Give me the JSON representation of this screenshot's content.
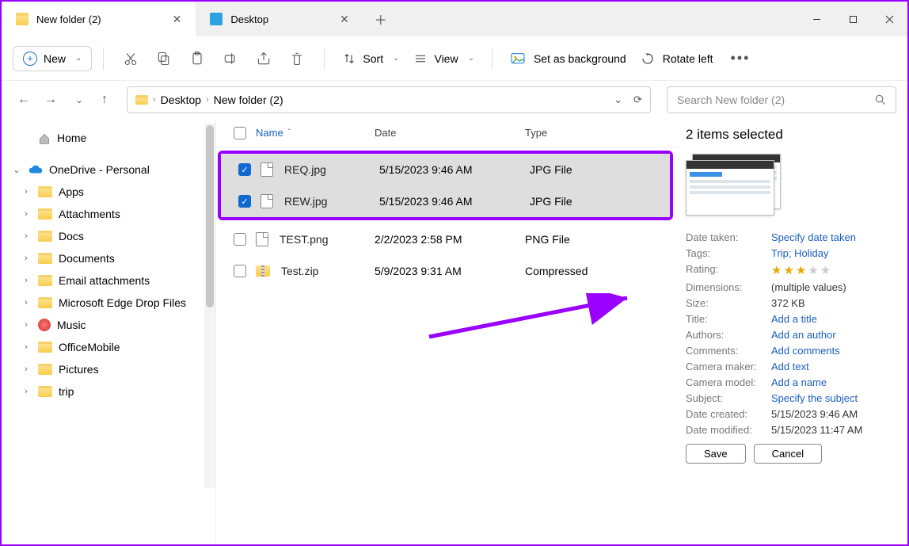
{
  "tabs": [
    {
      "label": "New folder (2)",
      "active": true
    },
    {
      "label": "Desktop",
      "active": false
    }
  ],
  "toolbar": {
    "new": "New",
    "sort": "Sort",
    "view": "View",
    "set_bg": "Set as background",
    "rotate": "Rotate left"
  },
  "breadcrumb": [
    "Desktop",
    "New folder (2)"
  ],
  "search": {
    "placeholder": "Search New folder (2)"
  },
  "nav": {
    "home": "Home",
    "onedrive": "OneDrive - Personal",
    "items": [
      "Apps",
      "Attachments",
      "Docs",
      "Documents",
      "Email attachments",
      "Microsoft Edge Drop Files",
      "Music",
      "OfficeMobile",
      "Pictures",
      "trip"
    ]
  },
  "columns": {
    "name": "Name",
    "date": "Date",
    "type": "Type"
  },
  "rows": [
    {
      "name": "REQ.jpg",
      "date": "5/15/2023 9:46 AM",
      "type": "JPG File",
      "selected": true,
      "icon": "file"
    },
    {
      "name": "REW.jpg",
      "date": "5/15/2023 9:46 AM",
      "type": "JPG File",
      "selected": true,
      "icon": "file"
    },
    {
      "name": "TEST.png",
      "date": "2/2/2023 2:58 PM",
      "type": "PNG File",
      "selected": false,
      "icon": "file"
    },
    {
      "name": "Test.zip",
      "date": "5/9/2023 9:31 AM",
      "type": "Compressed",
      "selected": false,
      "icon": "zip"
    }
  ],
  "details": {
    "title": "2 items selected",
    "rows": [
      {
        "k": "Date taken:",
        "v": "Specify date taken",
        "link": true
      },
      {
        "k": "Tags:",
        "v": "Trip; Holiday",
        "link": true
      },
      {
        "k": "Rating:",
        "v": "",
        "stars": 3
      },
      {
        "k": "Dimensions:",
        "v": "(multiple values)"
      },
      {
        "k": "Size:",
        "v": "372 KB"
      },
      {
        "k": "Title:",
        "v": "Add a title",
        "link": true
      },
      {
        "k": "Authors:",
        "v": "Add an author",
        "link": true
      },
      {
        "k": "Comments:",
        "v": "Add comments",
        "link": true
      },
      {
        "k": "Camera maker:",
        "v": "Add text",
        "link": true
      },
      {
        "k": "Camera model:",
        "v": "Add a name",
        "link": true
      },
      {
        "k": "Subject:",
        "v": "Specify the subject",
        "link": true
      },
      {
        "k": "Date created:",
        "v": "5/15/2023 9:46 AM"
      },
      {
        "k": "Date modified:",
        "v": "5/15/2023 11:47 AM"
      }
    ],
    "save": "Save",
    "cancel": "Cancel"
  }
}
